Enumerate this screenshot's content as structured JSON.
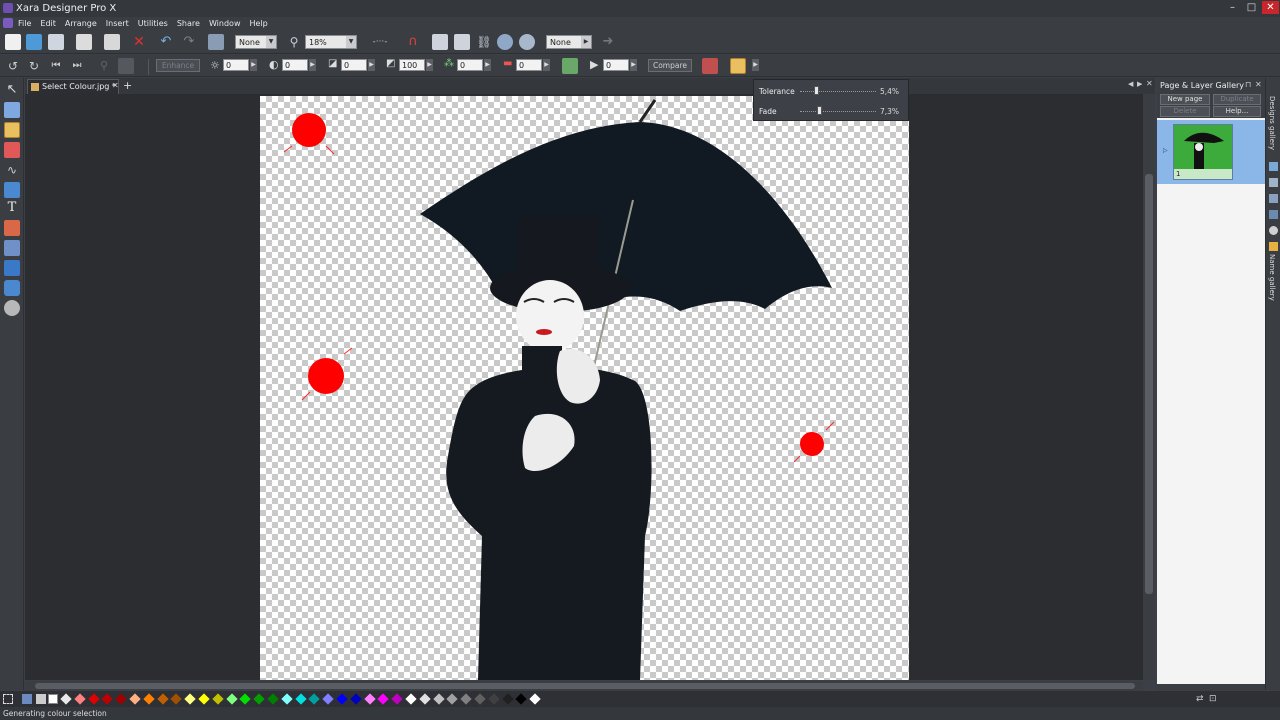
{
  "app": {
    "title": "Xara Designer Pro X"
  },
  "window_controls": {
    "minimize": "–",
    "maximize": "□",
    "close": "✕"
  },
  "menu": [
    "File",
    "Edit",
    "Arrange",
    "Insert",
    "Utilities",
    "Share",
    "Window",
    "Help"
  ],
  "toolbar1": {
    "quality_value": "None",
    "zoom_value": "18%",
    "snap_value": "None"
  },
  "toolbar2": {
    "enhance_label": "Enhance",
    "brightness_value": "0",
    "contrast_value": "0",
    "saturation_value": "0",
    "temperature_value": "100",
    "colour_value": "0",
    "blur_value": "0",
    "frame_value": "0",
    "compare_label": "Compare"
  },
  "tabs": [
    {
      "label": "Select Colour.jpg *"
    }
  ],
  "popup": {
    "tolerance_label": "Tolerance",
    "tolerance_value": "5,4%",
    "tolerance_level": 0.18,
    "fade_label": "Fade",
    "fade_value": "7,3%",
    "fade_level": 0.22
  },
  "gallery": {
    "title": "Page & Layer Gallery",
    "new_page_label": "New page",
    "duplicate_label": "Duplicate",
    "delete_label": "Delete",
    "help_label": "Help...",
    "page_number": "1"
  },
  "right_strip": {
    "designs_gallery": "Designs gallery",
    "name_gallery": "Name gallery"
  },
  "status": {
    "text": "Generating colour selection"
  },
  "palette": [
    "#e8e8e8",
    "#ff8080",
    "#e00000",
    "#c00000",
    "#a00000",
    "#ffb080",
    "#ff8000",
    "#c06000",
    "#a05000",
    "#ffff80",
    "#ffff00",
    "#c0c000",
    "#80ff80",
    "#00e000",
    "#00a000",
    "#008000",
    "#80ffff",
    "#00e0e0",
    "#00a0a0",
    "#8080ff",
    "#0000ff",
    "#0000c0",
    "#ff80ff",
    "#ff00ff",
    "#c000c0",
    "#ffffff",
    "#e0e0e0",
    "#c0c0c0",
    "#a0a0a0",
    "#808080",
    "#606060",
    "#404040",
    "#202020",
    "#000000",
    "#ffffff"
  ],
  "colors": {
    "accent_selected": "#8ab6e8",
    "marker_red": "#ff0000"
  }
}
